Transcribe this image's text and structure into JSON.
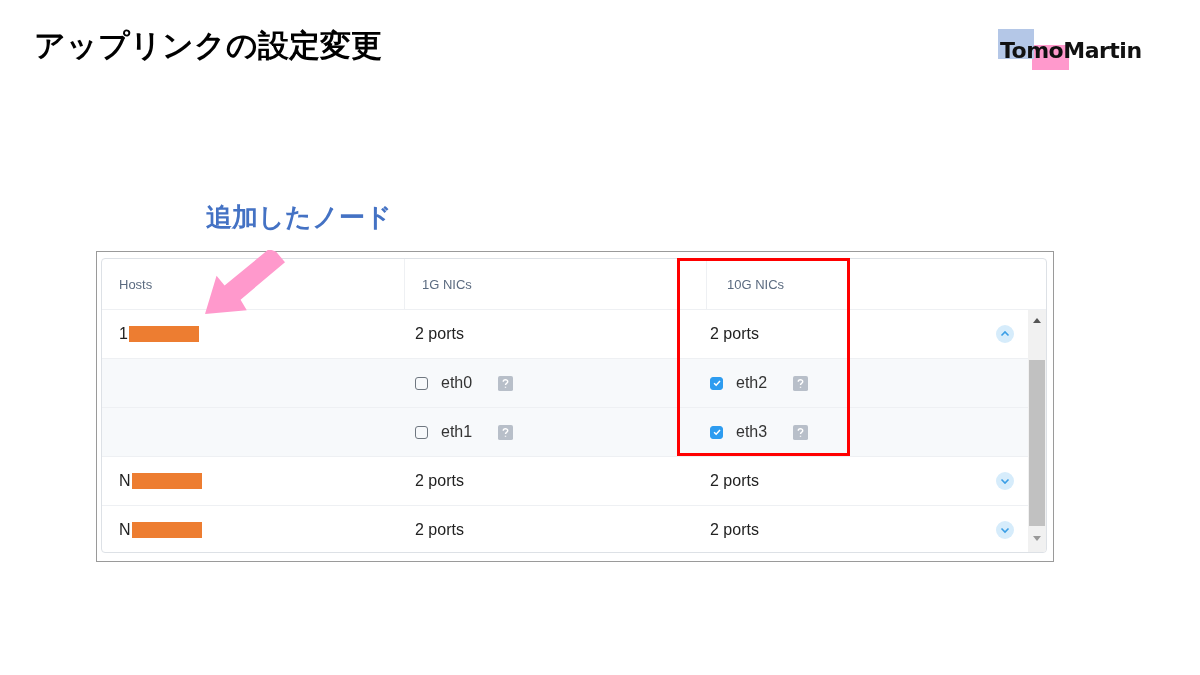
{
  "slide": {
    "title": "アップリンクの設定変更",
    "logo": "TomoMartin",
    "annotation": "追加したノード"
  },
  "table": {
    "columns": [
      "Hosts",
      "1G NICs",
      "10G NICs"
    ],
    "rows": [
      {
        "host": "1",
        "nics_1g": "2 ports",
        "nics_10g": "2 ports",
        "expanded": true,
        "ports": [
          {
            "nic_1g": {
              "name": "eth0",
              "checked": false
            },
            "nic_10g": {
              "name": "eth2",
              "checked": true
            }
          },
          {
            "nic_1g": {
              "name": "eth1",
              "checked": false
            },
            "nic_10g": {
              "name": "eth3",
              "checked": true
            }
          }
        ]
      },
      {
        "host": "N",
        "nics_1g": "2 ports",
        "nics_10g": "2 ports",
        "expanded": false
      },
      {
        "host": "N",
        "nics_1g": "2 ports",
        "nics_10g": "2 ports",
        "expanded": false
      }
    ]
  }
}
